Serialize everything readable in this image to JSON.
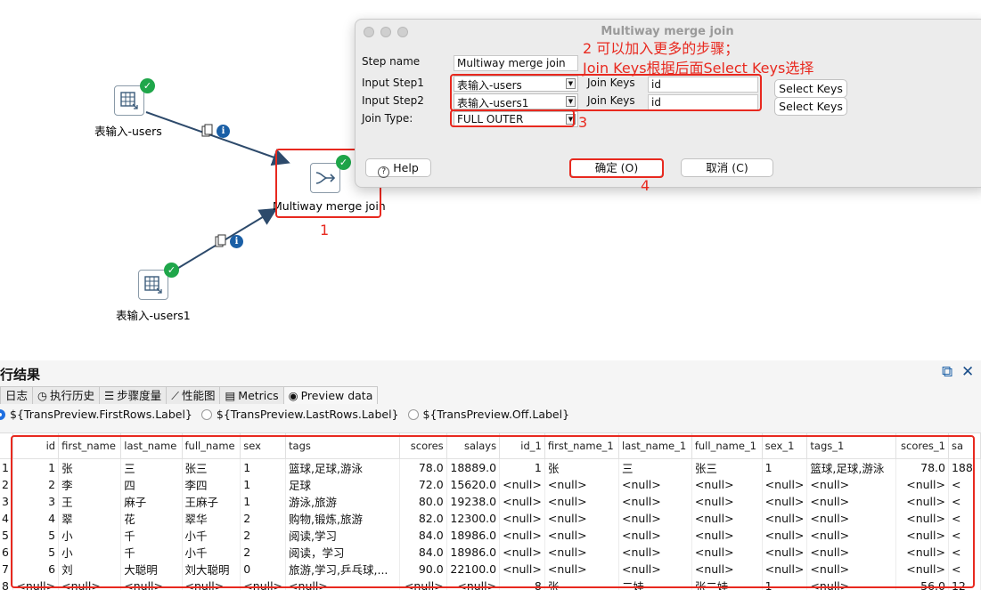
{
  "canvas": {
    "steps": [
      {
        "label": "表输入-users"
      },
      {
        "label": "Multiway merge join"
      },
      {
        "label": "表输入-users1"
      }
    ],
    "annotations": {
      "a1": "1",
      "a2_line1": "2 可以加入更多的步骤；",
      "a2_line2": "Join Keys根据后面Select Keys选择",
      "a3": "3",
      "a4": "4"
    }
  },
  "dialog": {
    "title": "Multiway merge join",
    "step_name_label": "Step name",
    "step_name_value": "Multiway merge join",
    "input_step1_label": "Input Step1",
    "input_step1_value": "表输入-users",
    "input_step2_label": "Input Step2",
    "input_step2_value": "表输入-users1",
    "join_keys_label": "Join Keys",
    "join_keys_1_value": "id",
    "join_keys_2_value": "id",
    "select_keys_label": "Select Keys",
    "join_type_label": "Join Type:",
    "join_type_value": "FULL OUTER",
    "help_label": "Help",
    "ok_label": "确定 (O)",
    "cancel_label": "取消 (C)"
  },
  "results": {
    "title": "行结果",
    "tabs": [
      {
        "label": "日志",
        "icon": "log-icon"
      },
      {
        "label": "执行历史",
        "icon": "history-icon"
      },
      {
        "label": "步骤度量",
        "icon": "step-metrics-icon"
      },
      {
        "label": "性能图",
        "icon": "chart-icon"
      },
      {
        "label": "Metrics",
        "icon": "metrics-icon"
      },
      {
        "label": "Preview data",
        "icon": "eye-icon"
      }
    ],
    "radio_first": "${TransPreview.FirstRows.Label}",
    "radio_last": "${TransPreview.LastRows.Label}",
    "radio_off": "${TransPreview.Off.Label}",
    "columns": [
      "id",
      "first_name",
      "last_name",
      "full_name",
      "sex",
      "tags",
      "scores",
      "salays",
      "id_1",
      "first_name_1",
      "last_name_1",
      "full_name_1",
      "sex_1",
      "tags_1",
      "scores_1",
      "sa"
    ],
    "rows": [
      [
        "1",
        "1",
        "张",
        "三",
        "张三",
        "1",
        "篮球,足球,游泳",
        "78.0",
        "18889.0",
        "1",
        "张",
        "三",
        "张三",
        "1",
        "篮球,足球,游泳",
        "78.0",
        "188"
      ],
      [
        "2",
        "2",
        "李",
        "四",
        "李四",
        "1",
        "足球",
        "72.0",
        "15620.0",
        "<null>",
        "<null>",
        "<null>",
        "<null>",
        "<null>",
        "<null>",
        "<null>",
        "<"
      ],
      [
        "3",
        "3",
        "王",
        "麻子",
        "王麻子",
        "1",
        "游泳,旅游",
        "80.0",
        "19238.0",
        "<null>",
        "<null>",
        "<null>",
        "<null>",
        "<null>",
        "<null>",
        "<null>",
        "<"
      ],
      [
        "4",
        "4",
        "翠",
        "花",
        "翠华",
        "2",
        "购物,锻炼,旅游",
        "82.0",
        "12300.0",
        "<null>",
        "<null>",
        "<null>",
        "<null>",
        "<null>",
        "<null>",
        "<null>",
        "<"
      ],
      [
        "5",
        "5",
        "小",
        "千",
        "小千",
        "2",
        "阅读,学习",
        "84.0",
        "18986.0",
        "<null>",
        "<null>",
        "<null>",
        "<null>",
        "<null>",
        "<null>",
        "<null>",
        "<"
      ],
      [
        "6",
        "5",
        "小",
        "千",
        "小千",
        "2",
        "阅读，学习",
        "84.0",
        "18986.0",
        "<null>",
        "<null>",
        "<null>",
        "<null>",
        "<null>",
        "<null>",
        "<null>",
        "<"
      ],
      [
        "7",
        "6",
        "刘",
        "大聪明",
        "刘大聪明",
        "0",
        "旅游,学习,乒乓球,...",
        "90.0",
        "22100.0",
        "<null>",
        "<null>",
        "<null>",
        "<null>",
        "<null>",
        "<null>",
        "<null>",
        "<"
      ],
      [
        "8",
        "<null>",
        "<null>",
        "<null>",
        "<null>",
        "<null>",
        "<null>",
        "<null>",
        "<null>",
        "8",
        "张",
        "二娃",
        "张二娃",
        "1",
        "<null>",
        "56.0",
        "12"
      ]
    ]
  }
}
